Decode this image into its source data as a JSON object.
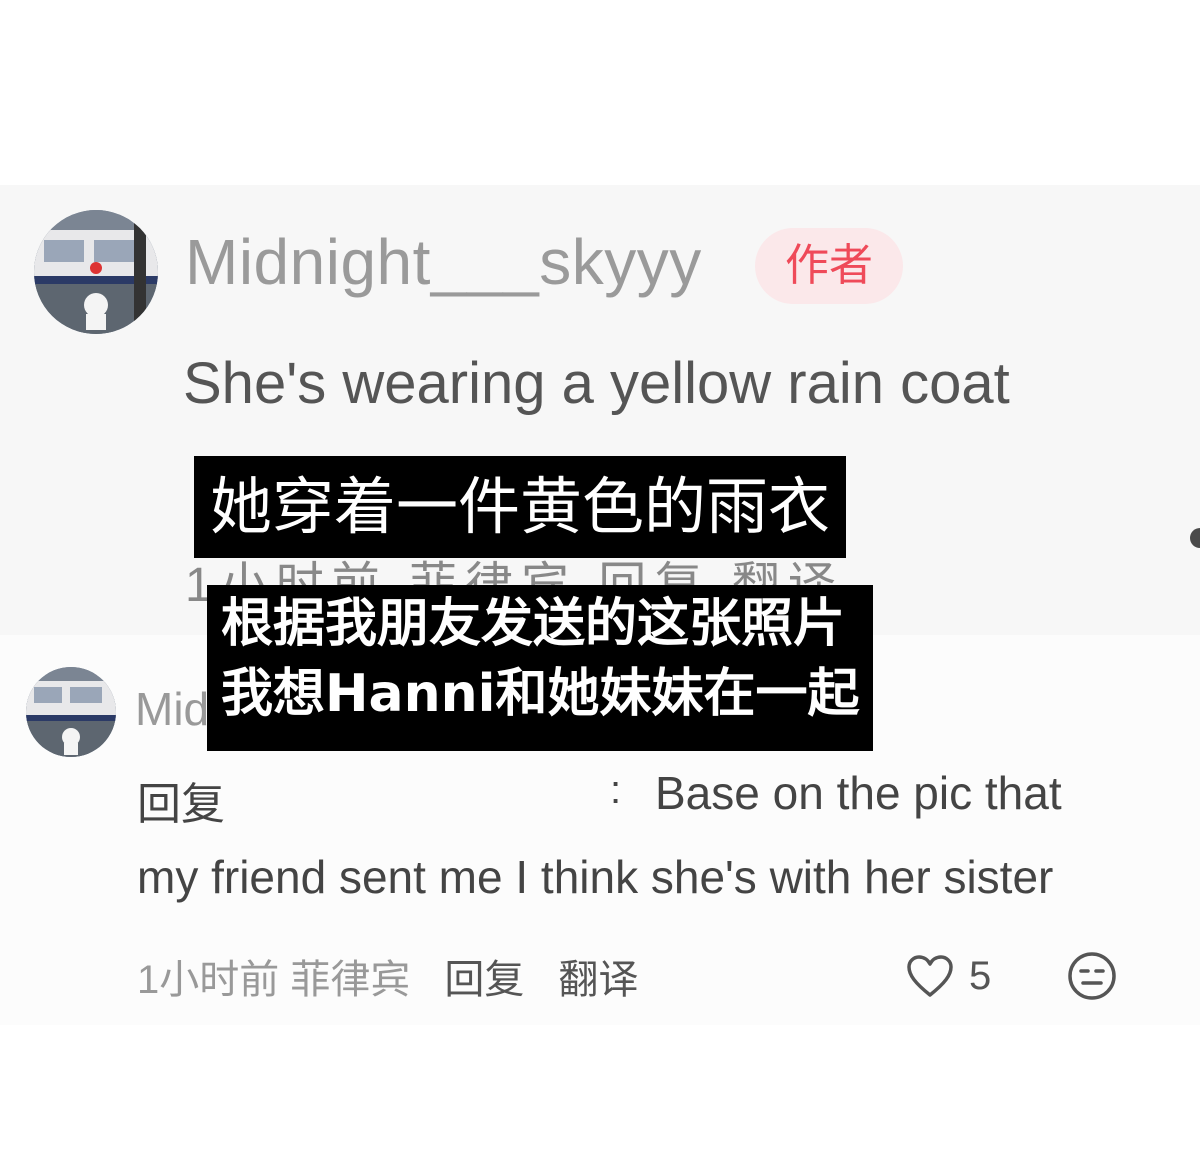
{
  "comment": {
    "username": "Midnight___skyyy",
    "author_badge": "作者",
    "text": "She's wearing a yellow rain coat",
    "meta_obscured": "1小时前 菲律宾 回复 翻译"
  },
  "reply": {
    "username_visible": "Mid",
    "prefix": "回复",
    "colon": ":",
    "text_line1": "Base on the pic that",
    "text_line2": "my friend sent me I think she's with her sister",
    "time_location": "1小时前 菲律宾",
    "reply_button": "回复",
    "translate_button": "翻译",
    "like_count": "5"
  },
  "captions": {
    "line1": "她穿着一件黄色的雨衣",
    "line2": "根据我朋友发送的这张照片",
    "line3": "我想Hanni和她妹妹在一起"
  },
  "colors": {
    "author_badge_bg": "#fbe8ea",
    "author_badge_text": "#ef4a59",
    "caption_bg": "#000000",
    "caption_text": "#ffffff"
  },
  "icons": {
    "like": "heart-outline-icon",
    "reaction": "neutral-face-icon"
  }
}
